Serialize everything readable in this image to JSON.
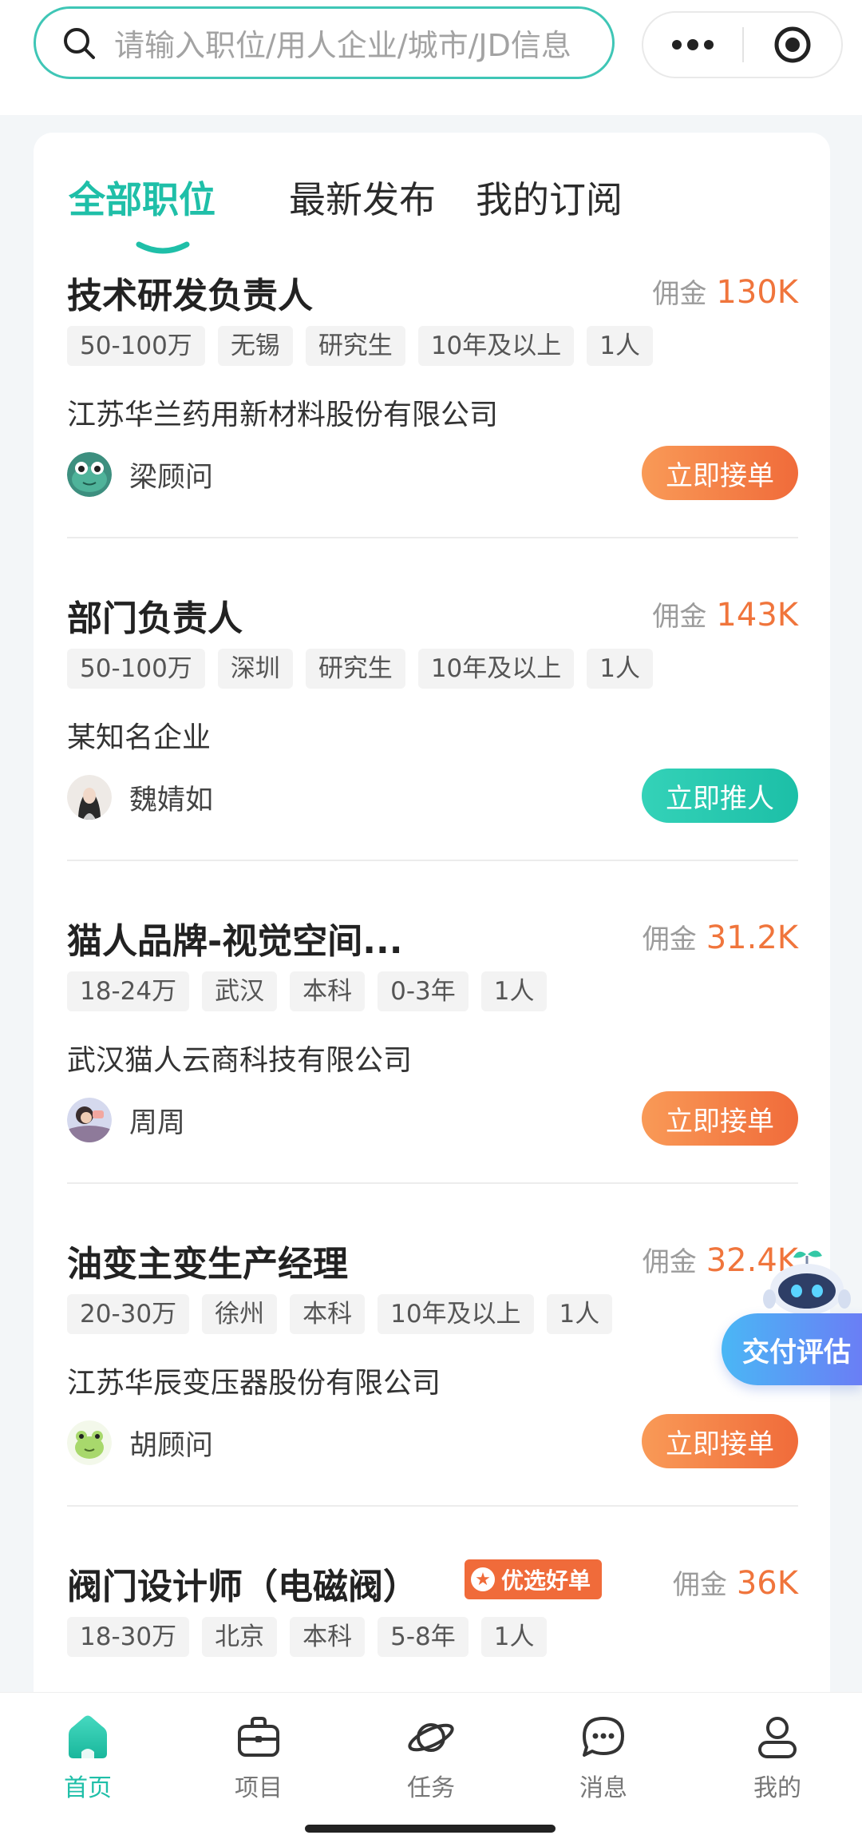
{
  "search": {
    "placeholder": "请输入职位/用人企业/城市/JD信息"
  },
  "tabs": [
    {
      "label": "全部职位",
      "active": true
    },
    {
      "label": "最新发布",
      "active": false
    },
    {
      "label": "我的订阅",
      "active": false
    }
  ],
  "jobs": [
    {
      "title": "技术研发负责人",
      "commission_label": "佣金",
      "commission": "130K",
      "tags": [
        "50-100万",
        "无锡",
        "研究生",
        "10年及以上",
        "1人"
      ],
      "company": "江苏华兰药用新材料股份有限公司",
      "consultant": "梁顾问",
      "action": "立即接单",
      "action_style": "orange"
    },
    {
      "title": "部门负责人",
      "commission_label": "佣金",
      "commission": "143K",
      "tags": [
        "50-100万",
        "深圳",
        "研究生",
        "10年及以上",
        "1人"
      ],
      "company": "某知名企业",
      "consultant": "魏婧如",
      "action": "立即推人",
      "action_style": "green"
    },
    {
      "title": "猫人品牌-视觉空间...",
      "commission_label": "佣金",
      "commission": "31.2K",
      "tags": [
        "18-24万",
        "武汉",
        "本科",
        "0-3年",
        "1人"
      ],
      "company": "武汉猫人云商科技有限公司",
      "consultant": "周周",
      "action": "立即接单",
      "action_style": "orange"
    },
    {
      "title": "油变主变生产经理",
      "commission_label": "佣金",
      "commission": "32.4K",
      "tags": [
        "20-30万",
        "徐州",
        "本科",
        "10年及以上",
        "1人"
      ],
      "company": "江苏华辰变压器股份有限公司",
      "consultant": "胡顾问",
      "action": "立即接单",
      "action_style": "orange"
    },
    {
      "title": "阀门设计师（电磁阀）",
      "badge": "优选好单",
      "commission_label": "佣金",
      "commission": "36K",
      "tags": [
        "18-30万",
        "北京",
        "本科",
        "5-8年",
        "1人"
      ]
    }
  ],
  "float_button": {
    "label": "交付评估"
  },
  "bottom_nav": [
    {
      "label": "首页",
      "icon": "home-icon",
      "active": true
    },
    {
      "label": "项目",
      "icon": "briefcase-icon",
      "active": false
    },
    {
      "label": "任务",
      "icon": "planet-icon",
      "active": false
    },
    {
      "label": "消息",
      "icon": "chat-icon",
      "active": false
    },
    {
      "label": "我的",
      "icon": "profile-icon",
      "active": false
    }
  ],
  "colors": {
    "accent": "#1fbfa8",
    "commission": "#f06b3a",
    "orange_button": "#f48149",
    "green_button": "#27c8af"
  }
}
